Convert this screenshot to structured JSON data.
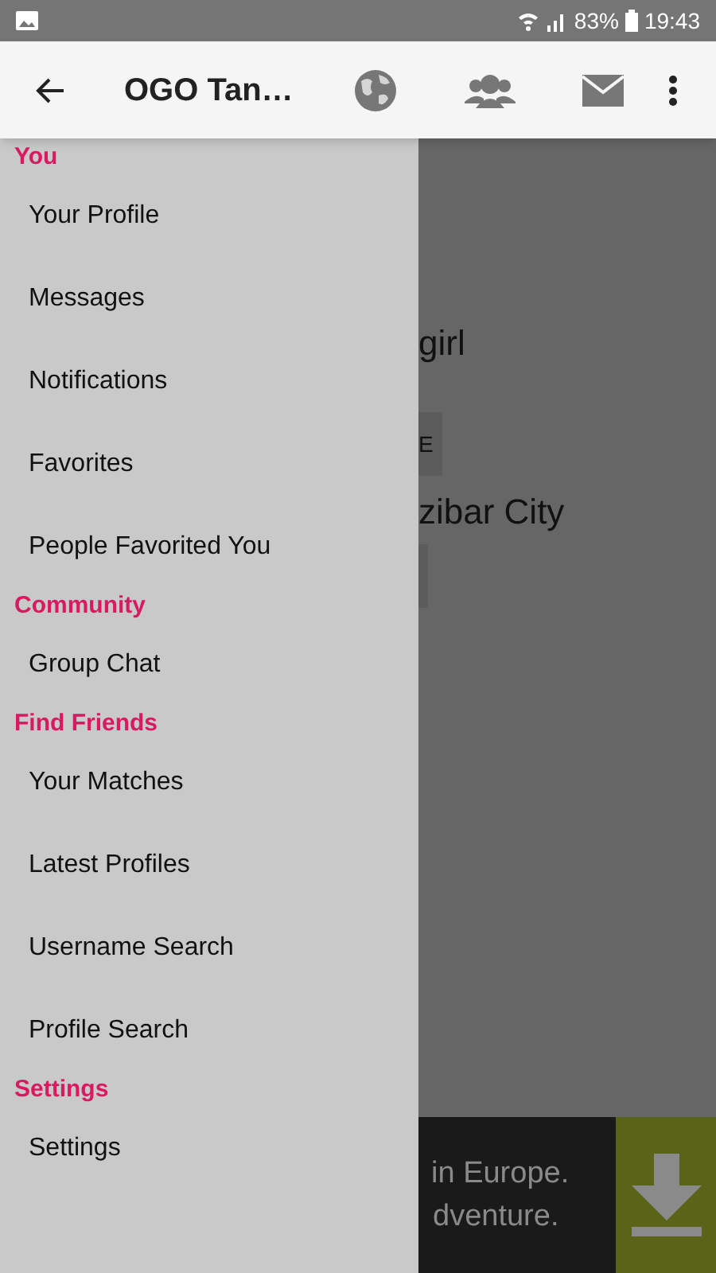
{
  "status_bar": {
    "battery": "83%",
    "time": "19:43"
  },
  "app_bar": {
    "title": "OGO Tan…"
  },
  "profile": {
    "name": "girl",
    "big_picture_button": "E",
    "details": "zibar City"
  },
  "ad": {
    "lines": [
      "in Europe.",
      "dventure."
    ]
  },
  "drawer": {
    "sections": [
      {
        "title": "You",
        "items": [
          "Your Profile",
          "Messages",
          "Notifications",
          "Favorites",
          "People Favorited You"
        ]
      },
      {
        "title": "Community",
        "items": [
          "Group Chat"
        ]
      },
      {
        "title": "Find Friends",
        "items": [
          "Your Matches",
          "Latest Profiles",
          "Username Search",
          "Profile Search"
        ]
      },
      {
        "title": "Settings",
        "items": [
          "Settings"
        ]
      }
    ]
  }
}
